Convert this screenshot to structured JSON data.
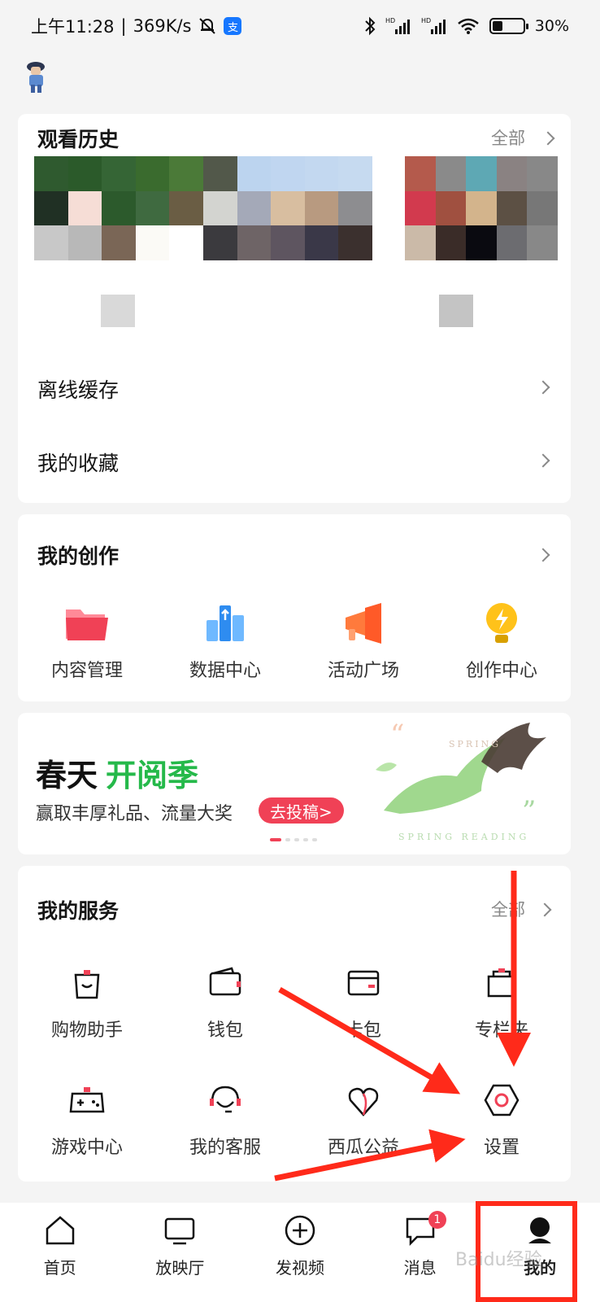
{
  "status_bar": {
    "time": "上午11:28",
    "speed": "369K/s",
    "battery": "30%",
    "battery_level": 0.3,
    "icons": [
      "mute-bell-icon",
      "alipay-icon",
      "bluetooth-icon",
      "hd-signal-icon",
      "hd-signal-icon",
      "wifi-icon",
      "battery-icon"
    ]
  },
  "history": {
    "title": "观看历史",
    "all_label": "全部",
    "thumb_colors": [
      [
        "#2f5a2f",
        "#2b5a2a",
        "#356535",
        "#3a6b2e",
        "#4b7a38",
        "#52584a",
        "#bcd4ef",
        "#c0d6f0",
        "#c3d8f0",
        "#c6daf0"
      ],
      [
        "#203024",
        "#f6ddd6",
        "#2c5a2c",
        "#3f6a40",
        "#6a5d44",
        "#d3d4d0",
        "#a4a9b8",
        "#d8bea0",
        "#b89a80",
        "#8d8d90"
      ],
      [
        "#c8c8c8",
        "#b8b8b8",
        "#7a6656",
        "#fbfaf6",
        "#ffffff",
        "#3b3a3e",
        "#6e6466",
        "#5e5560",
        "#3a3848",
        "#3b302e"
      ]
    ],
    "thumb2_colors": [
      [
        "#b45a4c",
        "#8a8a8a",
        "#5ea8b4",
        "#8a8282",
        "#888888"
      ],
      [
        "#d23a4e",
        "#a05040",
        "#d3b48c",
        "#5c5044",
        "#777777"
      ],
      [
        "#cbbaa8",
        "#3a2c28",
        "#0a0a10",
        "#6c6c70",
        "#888888"
      ]
    ]
  },
  "menu": {
    "offline_cache": "离线缓存",
    "favorites": "我的收藏"
  },
  "creation": {
    "title": "我的创作",
    "items": [
      {
        "label": "内容管理",
        "icon": "folder-icon"
      },
      {
        "label": "数据中心",
        "icon": "data-chart-icon"
      },
      {
        "label": "活动广场",
        "icon": "megaphone-icon"
      },
      {
        "label": "创作中心",
        "icon": "lightbulb-icon"
      }
    ]
  },
  "banner": {
    "title_main": "春天",
    "title_highlight": "开阅季",
    "subtitle": "赢取丰厚礼品、流量大奖",
    "cta": "去投稿>",
    "deco_top": "SPRING",
    "deco_bottom": "SPRING READING",
    "slide_count": 5,
    "active_slide": 1
  },
  "services": {
    "title": "我的服务",
    "all_label": "全部",
    "items": [
      {
        "label": "购物助手",
        "icon": "shopping-bag-icon"
      },
      {
        "label": "钱包",
        "icon": "wallet-icon"
      },
      {
        "label": "卡包",
        "icon": "card-icon"
      },
      {
        "label": "专栏夹",
        "icon": "bag-icon"
      },
      {
        "label": "游戏中心",
        "icon": "gamepad-icon"
      },
      {
        "label": "我的客服",
        "icon": "headset-icon"
      },
      {
        "label": "西瓜公益",
        "icon": "charity-heart-icon"
      },
      {
        "label": "设置",
        "icon": "settings-icon"
      }
    ]
  },
  "tabbar": {
    "items": [
      {
        "label": "首页",
        "icon": "home-icon"
      },
      {
        "label": "放映厅",
        "icon": "tv-icon"
      },
      {
        "label": "发视频",
        "icon": "add-circle-icon"
      },
      {
        "label": "消息",
        "icon": "message-icon",
        "badge": "1"
      },
      {
        "label": "我的",
        "icon": "profile-icon"
      }
    ]
  },
  "watermark": "Baidu经验",
  "colors": {
    "accent": "#f04156",
    "green": "#25b94a",
    "annotation_red": "#ff2a1a"
  }
}
